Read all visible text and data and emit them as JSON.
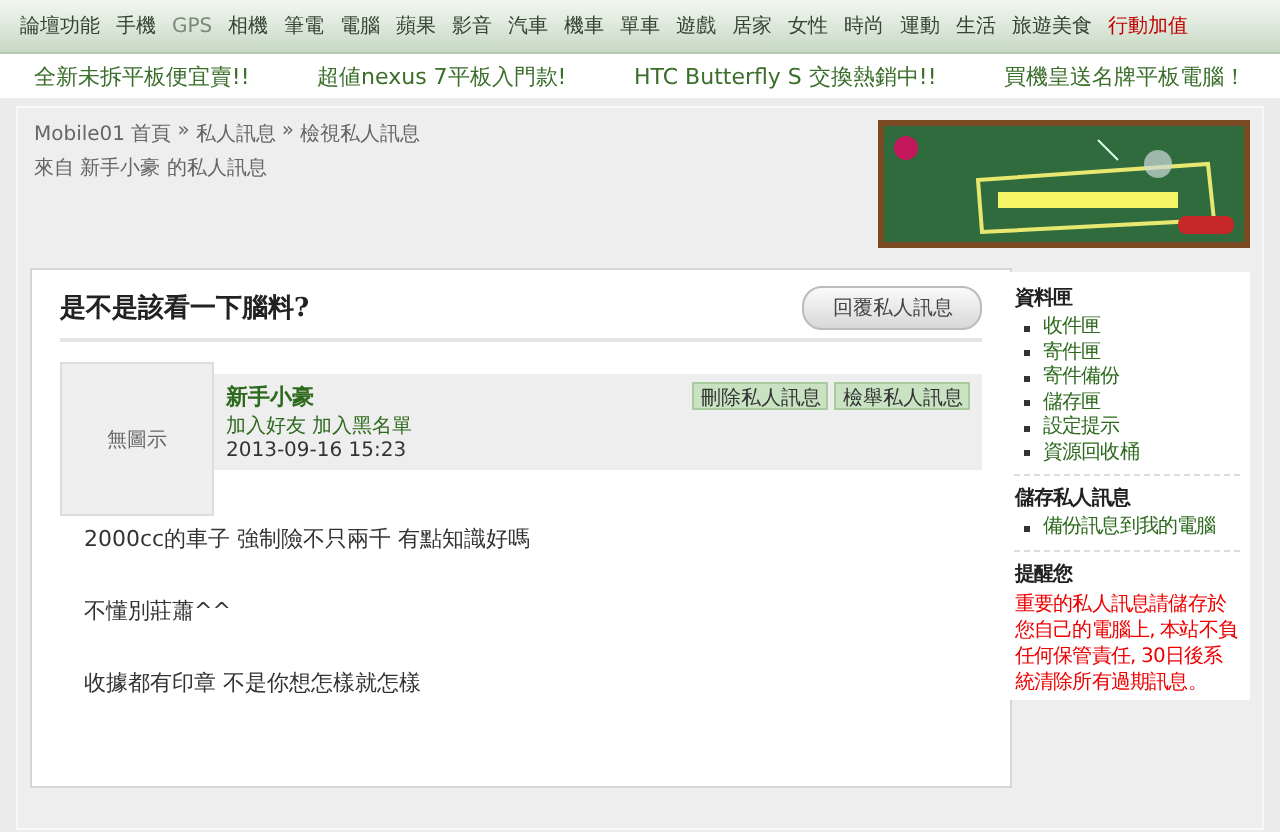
{
  "nav": {
    "items": [
      {
        "label": "論壇功能",
        "kind": "normal"
      },
      {
        "label": "手機",
        "kind": "normal"
      },
      {
        "label": "GPS",
        "kind": "muted"
      },
      {
        "label": "相機",
        "kind": "normal"
      },
      {
        "label": "筆電",
        "kind": "normal"
      },
      {
        "label": "電腦",
        "kind": "normal"
      },
      {
        "label": "蘋果",
        "kind": "normal"
      },
      {
        "label": "影音",
        "kind": "normal"
      },
      {
        "label": "汽車",
        "kind": "normal"
      },
      {
        "label": "機車",
        "kind": "normal"
      },
      {
        "label": "單車",
        "kind": "normal"
      },
      {
        "label": "遊戲",
        "kind": "normal"
      },
      {
        "label": "居家",
        "kind": "normal"
      },
      {
        "label": "女性",
        "kind": "normal"
      },
      {
        "label": "時尚",
        "kind": "normal"
      },
      {
        "label": "運動",
        "kind": "normal"
      },
      {
        "label": "生活",
        "kind": "normal"
      },
      {
        "label": "旅遊美食",
        "kind": "normal"
      },
      {
        "label": "行動加值",
        "kind": "highlight"
      }
    ]
  },
  "promos": [
    "全新未拆平板便宜賣!!",
    "超値nexus 7平板入門款!",
    "HTC Butterfly S 交換熱銷中!!",
    "買機皇送名牌平板電腦！"
  ],
  "breadcrumb": [
    "Mobile01 首頁",
    "私人訊息",
    "檢視私人訊息"
  ],
  "breadcrumb_separator": "»",
  "subtitle": "來自 新手小豪 的私人訊息",
  "message": {
    "title": "是不是該看一下腦料?",
    "reply_button": "回覆私人訊息",
    "avatar_text": "無圖示",
    "sender": "新手小豪",
    "links": [
      "加入好友",
      "加入黑名單"
    ],
    "date": "2013-09-16 15:23",
    "actions": [
      "刪除私人訊息",
      "檢舉私人訊息"
    ],
    "body": [
      "2000cc的車子 強制險不只兩千 有點知識好嗎",
      "不懂別莊蕭^^",
      "收據都有印章 不是你想怎樣就怎樣"
    ]
  },
  "sidebar": {
    "sections": [
      {
        "title": "資料匣",
        "items": [
          "收件匣",
          "寄件匣",
          "寄件備份",
          "儲存匣",
          "設定提示",
          "資源回收桶"
        ]
      },
      {
        "title": "儲存私人訊息",
        "items": [
          "備份訊息到我的電腦"
        ]
      },
      {
        "title": "提醒您",
        "note": "重要的私人訊息請儲存於您自己的電腦上, 本站不負任何保管責任, 30日後系統清除所有過期訊息。"
      }
    ]
  }
}
